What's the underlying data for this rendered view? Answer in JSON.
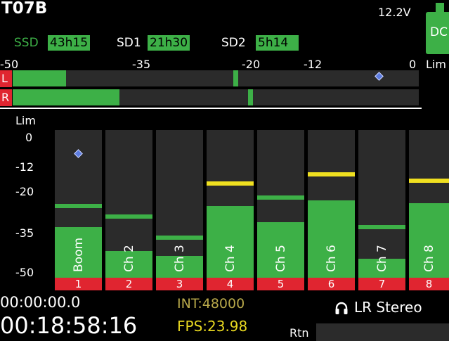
{
  "device": {
    "name": "T07B",
    "voltage": "12.2V",
    "power_source": "DC"
  },
  "media": [
    {
      "label": "SSD",
      "value": "43h15"
    },
    {
      "label": "SD1",
      "value": "21h30"
    },
    {
      "label": "SD2",
      "value": "5h14"
    }
  ],
  "output_scale": [
    "-50",
    "-35",
    "-20",
    "-12",
    "0",
    "Lim"
  ],
  "output_meters": [
    {
      "label": "L",
      "level_db": -44,
      "peak_db": -23
    },
    {
      "label": "R",
      "level_db": -38,
      "peak_db": -21
    }
  ],
  "channel_scale": [
    "Lim",
    "0",
    "-12",
    "-20",
    "-35",
    "-50"
  ],
  "channels": [
    {
      "number": "1",
      "name": "Boom",
      "level_db": -34,
      "peak_db": -26,
      "peak_color": "green",
      "clip_marker": true
    },
    {
      "number": "2",
      "name": "Ch 2",
      "level_db": -43,
      "peak_db": -30,
      "peak_color": "green"
    },
    {
      "number": "3",
      "name": "Ch 3",
      "level_db": -45,
      "peak_db": -38,
      "peak_color": "green"
    },
    {
      "number": "4",
      "name": "Ch 4",
      "level_db": -26,
      "peak_db": -18,
      "peak_color": "yellow"
    },
    {
      "number": "5",
      "name": "Ch 5",
      "level_db": -32,
      "peak_db": -23,
      "peak_color": "green"
    },
    {
      "number": "6",
      "name": "Ch 6",
      "level_db": -24,
      "peak_db": -15,
      "peak_color": "yellow"
    },
    {
      "number": "7",
      "name": "Ch 7",
      "level_db": -46,
      "peak_db": -34,
      "peak_color": "green"
    },
    {
      "number": "8",
      "name": "Ch 8",
      "level_db": -25,
      "peak_db": -17,
      "peak_color": "yellow"
    }
  ],
  "status": {
    "timecode_small": "00:00:00.0",
    "timecode_large": "00:18:58:16",
    "sample_rate": "INT:48000",
    "fps": "FPS:23.98",
    "headphone_mode": "LR Stereo",
    "return_label": "Rtn"
  },
  "colors": {
    "meter_green": "#3db047",
    "peak_yellow": "#f0e020",
    "track_red": "#e02530",
    "meter_bg": "#2b2b2b"
  }
}
